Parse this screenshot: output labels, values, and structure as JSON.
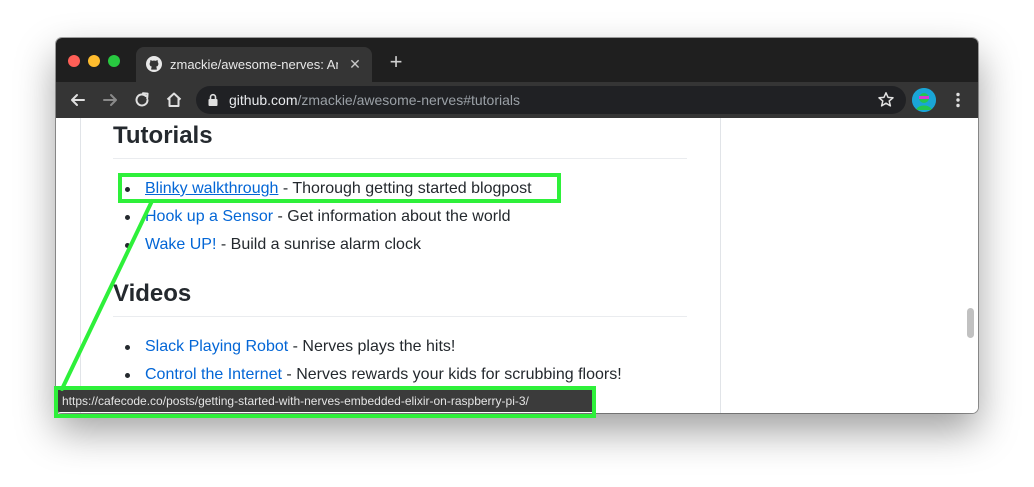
{
  "browser": {
    "tab": {
      "title": "zmackie/awesome-nerves: An",
      "close_icon": "close-icon",
      "favicon": "github-icon"
    },
    "new_tab_symbol": "+",
    "nav": {
      "back_icon": "back-arrow-icon",
      "forward_icon": "forward-arrow-icon",
      "reload_icon": "reload-icon",
      "home_icon": "home-icon"
    },
    "address": {
      "host": "github.com",
      "path": "/zmackie/awesome-nerves#tutorials",
      "lock_icon": "lock-icon",
      "bookmark_icon": "star-icon"
    },
    "profile_icon": "avatar",
    "menu_icon": "vertical-dots-icon"
  },
  "page": {
    "sections": [
      {
        "heading": "Tutorials",
        "items": [
          {
            "link": "Blinky walkthrough",
            "desc": " - Thorough getting started blogpost",
            "hovered": true
          },
          {
            "link": "Hook up a Sensor",
            "desc": " - Get information about the world"
          },
          {
            "link": "Wake UP!",
            "desc": " - Build a sunrise alarm clock"
          }
        ]
      },
      {
        "heading": "Videos",
        "items": [
          {
            "link": "Slack Playing Robot",
            "desc": " - Nerves plays the hits!"
          },
          {
            "link": "Control the Internet",
            "desc": " - Nerves rewards your kids for scrubbing floors!"
          }
        ]
      }
    ]
  },
  "status_bar": {
    "url": "https://cafecode.co/posts/getting-started-with-nerves-embedded-elixir-on-raspberry-pi-3/"
  },
  "annotation": {
    "highlight_color": "#2ef03a"
  }
}
